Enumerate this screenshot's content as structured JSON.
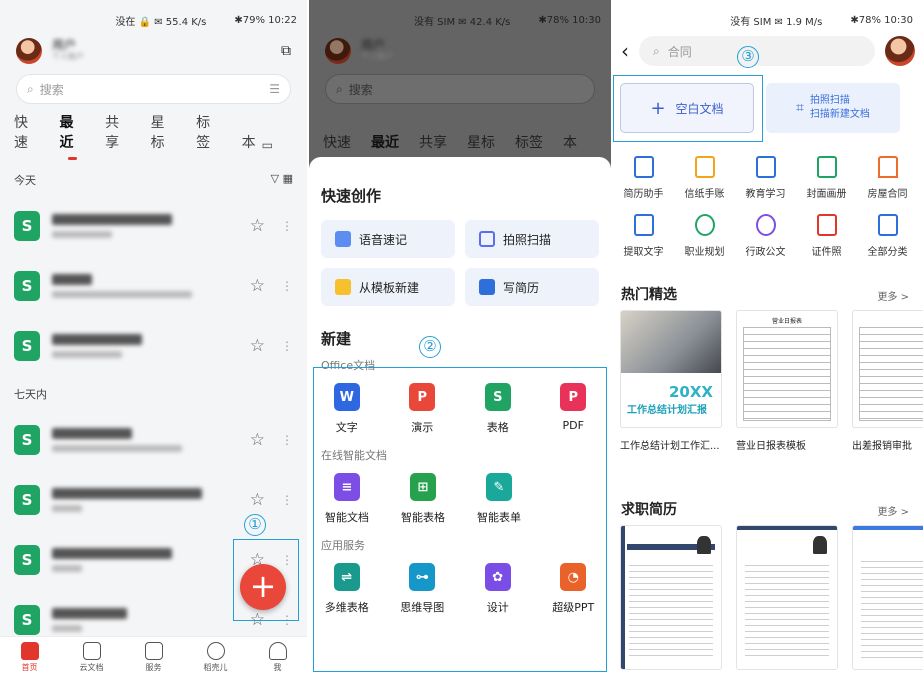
{
  "p1": {
    "status_left": "没在 🔒 ✉ 55.4 K/s",
    "status_right": "✱79% 10:22",
    "search": "搜索",
    "tabs": [
      "快速",
      "最近",
      "共享",
      "星标",
      "标签",
      "本"
    ],
    "today": "今天",
    "week": "七天内",
    "nav": [
      "首页",
      "云文档",
      "服务",
      "稻壳儿",
      "我"
    ],
    "fab": "+"
  },
  "p2": {
    "status_left": "没有 SIM ✉ 42.4 K/s",
    "status_right": "✱78% 10:30",
    "search": "搜索",
    "tabs": [
      "快速",
      "最近",
      "共享",
      "星标",
      "标签",
      "本"
    ],
    "quick_title": "快速创作",
    "quick": [
      "语音速记",
      "拍照扫描",
      "从模板新建",
      "写简历"
    ],
    "new_title": "新建",
    "g1": "Office文档",
    "g1_items": [
      "文字",
      "演示",
      "表格",
      "PDF"
    ],
    "g2": "在线智能文档",
    "g2_items": [
      "智能文档",
      "智能表格",
      "智能表单"
    ],
    "g3": "应用服务",
    "g3_items": [
      "多维表格",
      "思维导图",
      "设计",
      "超级PPT"
    ]
  },
  "p3": {
    "status_left": "没有 SIM ✉ 1.9 M/s",
    "status_right": "✱78% 10:30",
    "search": "合同",
    "blank": "空白文档",
    "scan1": "拍照扫描",
    "scan2": "扫描新建文档",
    "cats": [
      "简历助手",
      "信纸手账",
      "教育学习",
      "封面画册",
      "房屋合同",
      "提取文字",
      "职业规划",
      "行政公文",
      "证件照",
      "全部分类"
    ],
    "hot": "热门精选",
    "more": "更多 >",
    "hot_items": [
      "工作总结计划工作汇...",
      "营业日报表模板",
      "出差报销审批"
    ],
    "cover_year": "20XX",
    "cover_text": "工作总结计划汇报",
    "sheet_title": "营业日报表",
    "resume": "求职简历",
    "more2": "更多 >"
  },
  "callouts": [
    "①",
    "②",
    "③"
  ]
}
